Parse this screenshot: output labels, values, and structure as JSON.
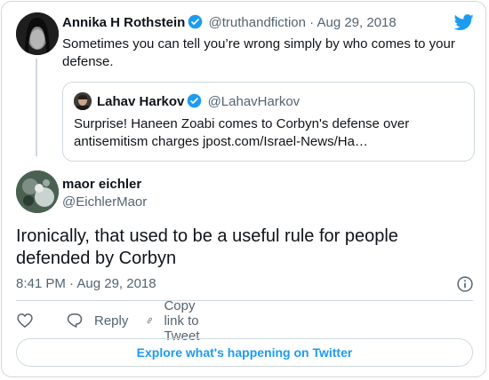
{
  "colors": {
    "accent": "#1d9bf0",
    "text": "#0f1419",
    "secondary": "#536471",
    "border": "#cfd9de"
  },
  "parent_tweet": {
    "name": "Annika H Rothstein",
    "handle": "@truthandfiction",
    "separator": "·",
    "date": "Aug 29, 2018",
    "text": "Sometimes you can tell you’re wrong simply by who comes to your defense.",
    "verified": true
  },
  "quoted_tweet": {
    "name": "Lahav Harkov",
    "handle": "@LahavHarkov",
    "text": "Surprise! Haneen Zoabi comes to Corbyn's defense over antisemitism charges jpost.com/Israel-News/Ha…",
    "verified": true
  },
  "main_tweet": {
    "name": "maor eichler",
    "handle": "@EichlerMaor",
    "text": "Ironically, that used to be a useful rule for people defended by Corbyn",
    "timestamp": "8:41 PM · Aug 29, 2018"
  },
  "actions": {
    "like_icon": "heart-icon",
    "reply_label": "Reply",
    "copy_link_label": "Copy link to Tweet"
  },
  "explore_label": "Explore what's happening on Twitter"
}
